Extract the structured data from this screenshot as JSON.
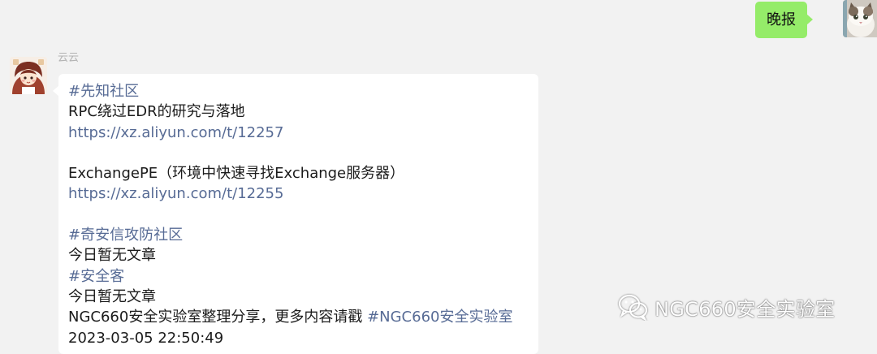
{
  "chat": {
    "outgoing": {
      "text": "晚报"
    },
    "incoming": {
      "sender": "云云",
      "lines": {
        "l1": "#先知社区",
        "l2": "RPC绕过EDR的研究与落地",
        "l3": "https://xz.aliyun.com/t/12257",
        "l4": "",
        "l5": "ExchangePE（环境中快速寻找Exchange服务器）",
        "l6": "https://xz.aliyun.com/t/12255",
        "l7": "",
        "l8": "#奇安信攻防社区",
        "l9": "今日暂无文章",
        "l10": "#安全客",
        "l11": "今日暂无文章",
        "l12_prefix": "NGC660安全实验室整理分享，更多内容请戳 ",
        "l12_tag": "#NGC660安全实验室",
        "l13": "2023-03-05 22:50:49"
      }
    }
  },
  "watermark": {
    "text": "NGC660安全实验室"
  },
  "colors": {
    "background": "#f2f2f2",
    "bubble_out": "#95ec69",
    "bubble_in": "#ffffff",
    "link": "#576b95",
    "name": "#b2b2b2"
  }
}
